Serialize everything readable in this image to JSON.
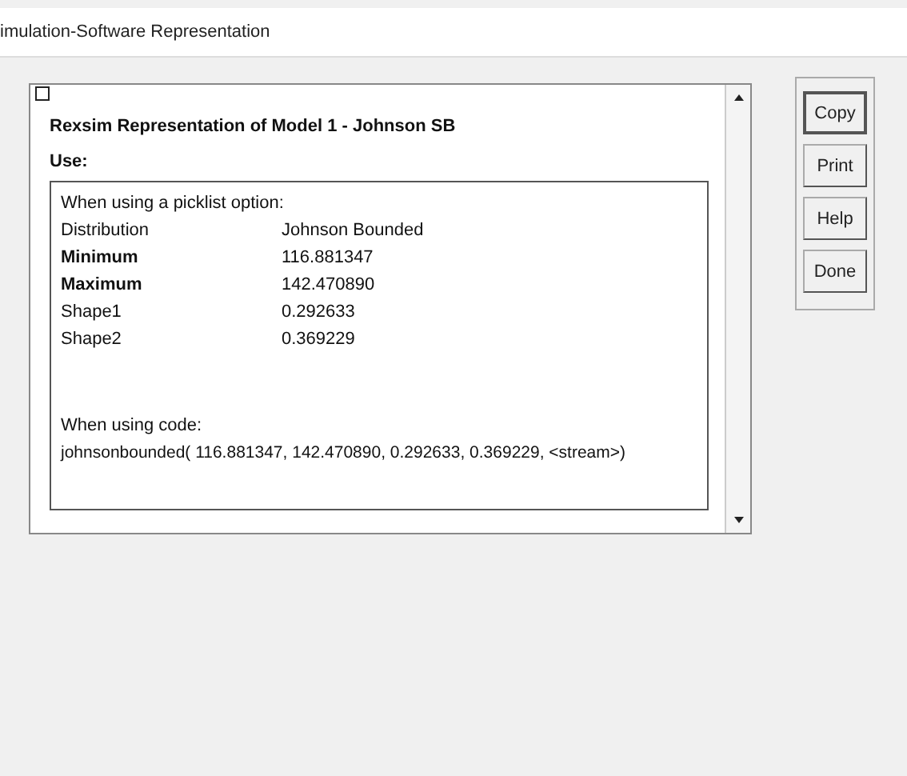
{
  "window": {
    "title": "imulation-Software Representation"
  },
  "document": {
    "heading": "Rexsim Representation of Model 1 - Johnson SB",
    "use_label": "Use:",
    "picklist_heading": "When using a picklist option:",
    "rows": [
      {
        "label": "Distribution",
        "value": "Johnson Bounded",
        "bold": false
      },
      {
        "label": "Minimum",
        "value": "116.881347",
        "bold": true
      },
      {
        "label": "Maximum",
        "value": "142.470890",
        "bold": true
      },
      {
        "label": "Shape1",
        "value": "0.292633",
        "bold": false
      },
      {
        "label": "Shape2",
        "value": "0.369229",
        "bold": false
      }
    ],
    "code_heading": "When using code:",
    "code": "johnsonbounded( 116.881347, 142.470890, 0.292633, 0.369229, <stream>)"
  },
  "buttons": [
    {
      "label": "Copy",
      "focused": true
    },
    {
      "label": "Print",
      "focused": false
    },
    {
      "label": "Help",
      "focused": false
    },
    {
      "label": "Done",
      "focused": false
    }
  ]
}
